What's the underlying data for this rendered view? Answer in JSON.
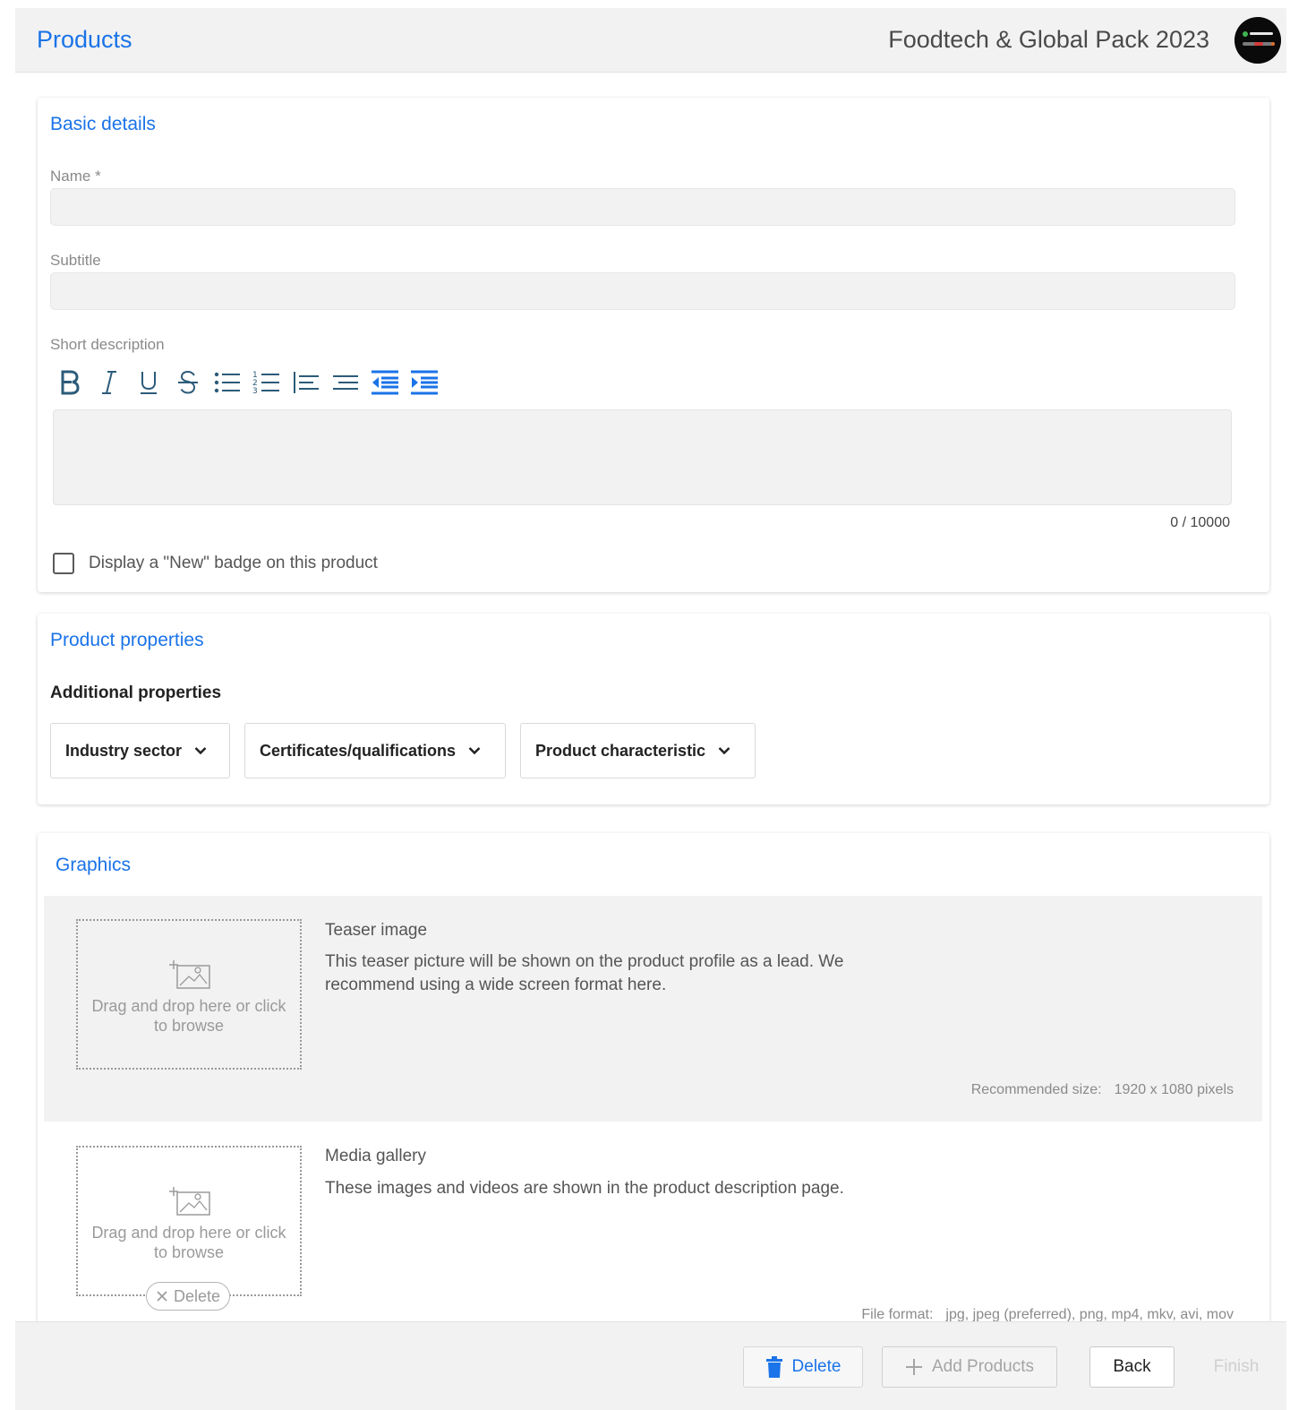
{
  "header": {
    "title": "Products",
    "event_name": "Foodtech & Global Pack 2023",
    "avatar_icon": "event-logo-icon"
  },
  "basic_details": {
    "title": "Basic details",
    "name_label": "Name *",
    "name_value": "",
    "subtitle_label": "Subtitle",
    "subtitle_value": "",
    "short_description_label": "Short description",
    "toolbar": [
      "bold-icon",
      "italic-icon",
      "underline-icon",
      "strikethrough-icon",
      "bulleted-list-icon",
      "numbered-list-icon",
      "align-left-icon",
      "list-icon",
      "outdent-icon",
      "indent-icon"
    ],
    "char_count": "0 / 10000",
    "new_badge_label": "Display a \"New\" badge on this product",
    "new_badge_checked": false
  },
  "product_properties": {
    "title": "Product properties",
    "subheading": "Additional properties",
    "dropdowns": [
      "Industry sector",
      "Certificates/qualifications",
      "Product characteristic"
    ]
  },
  "graphics": {
    "title": "Graphics",
    "teaser": {
      "dropzone_text": "Drag and drop here or click to browse",
      "title": "Teaser image",
      "description": "This teaser picture will be shown on the product profile as a lead. We recommend using a wide screen format here.",
      "meta_label": "Recommended size:",
      "meta_value": "1920 x 1080 pixels"
    },
    "media": {
      "dropzone_text": "Drag and drop here or click to browse",
      "title": "Media gallery",
      "description": "These images and videos are shown in the product description page.",
      "delete_label": "Delete",
      "meta_label": "File format:",
      "meta_value": "jpg, jpeg (preferred), png, mp4, mkv, avi, mov"
    }
  },
  "footer": {
    "delete_label": "Delete",
    "add_label": "Add Products",
    "back_label": "Back",
    "finish_label": "Finish"
  },
  "colors": {
    "accent": "#1a73e8",
    "panel": "#f2f2f2"
  }
}
